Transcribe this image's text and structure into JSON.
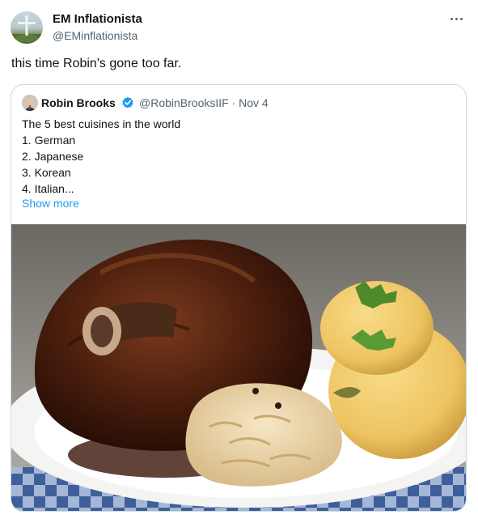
{
  "tweet": {
    "author_name": "EM Inflationista",
    "author_handle": "@EMinflationista",
    "text": "this time Robin's gone too far.",
    "more_icon": "more-horizontal-icon"
  },
  "quoted": {
    "author_name": "Robin Brooks",
    "verified_icon": "verified-badge-icon",
    "verified_color": "#1d9bf0",
    "meta": "@RobinBrooksIIF · Nov 4",
    "lines": [
      "The 5 best cuisines in the world",
      "1. German",
      "2. Japanese",
      "3. Korean",
      "4. Italian..."
    ],
    "show_more": "Show more"
  },
  "colors": {
    "text": "#0f1419",
    "secondary": "#536471",
    "link": "#1d9bf0",
    "border": "#cfd9de"
  }
}
